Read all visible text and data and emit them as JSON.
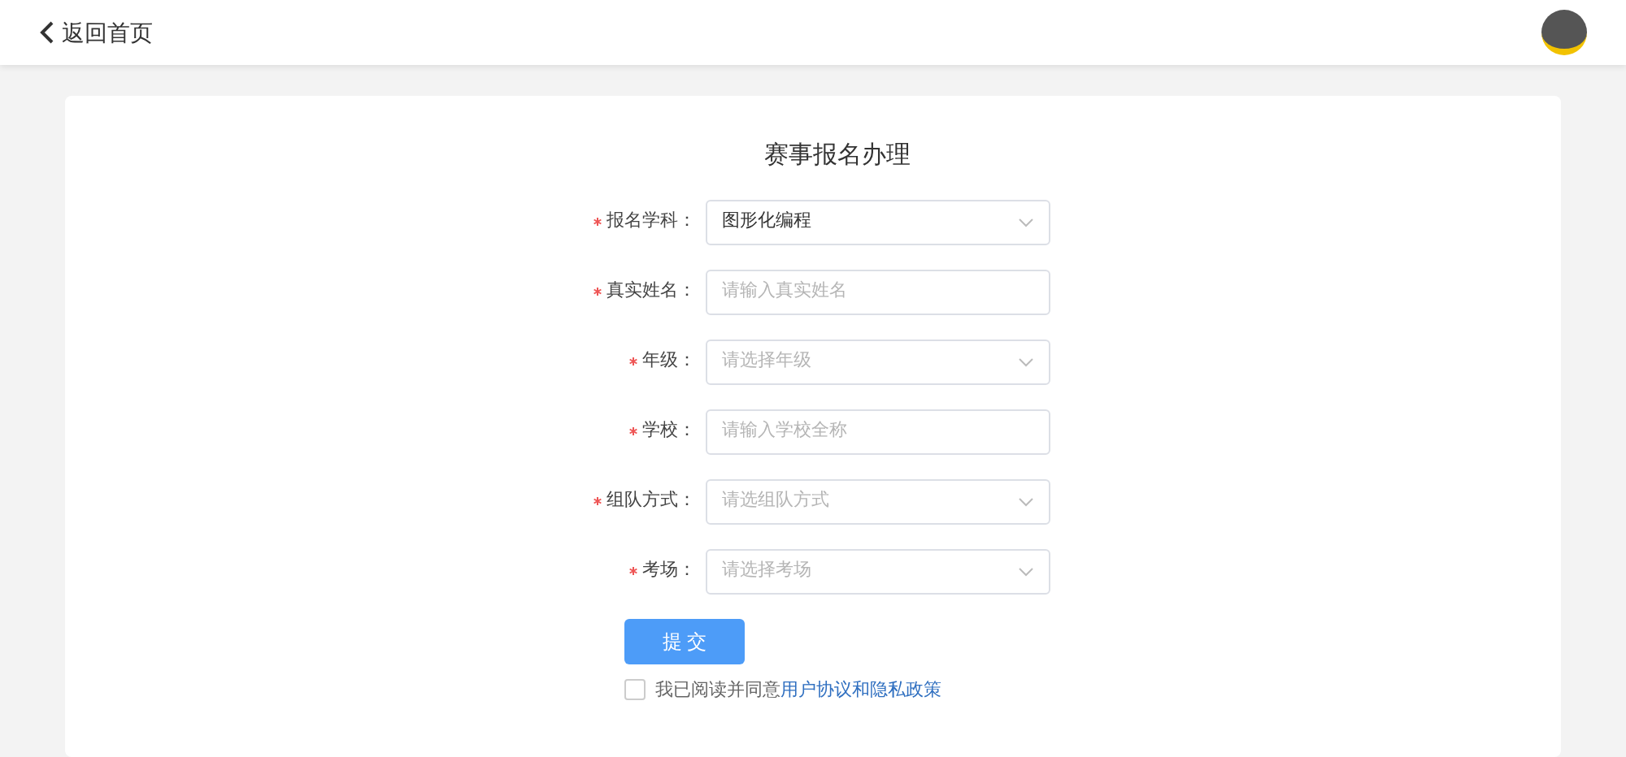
{
  "header": {
    "back_label": "返回首页"
  },
  "form": {
    "title": "赛事报名办理",
    "fields": [
      {
        "kind": "select",
        "label": "报名学科：",
        "required": true,
        "value": "图形化编程"
      },
      {
        "kind": "input",
        "label": "真实姓名：",
        "required": true,
        "placeholder": "请输入真实姓名"
      },
      {
        "kind": "select",
        "label": "年级：",
        "required": true,
        "placeholder": "请选择年级"
      },
      {
        "kind": "input",
        "label": "学校：",
        "required": true,
        "placeholder": "请输入学校全称"
      },
      {
        "kind": "select",
        "label": "组队方式：",
        "required": true,
        "placeholder": "请选组队方式"
      },
      {
        "kind": "select",
        "label": "考场：",
        "required": true,
        "placeholder": "请选择考场"
      }
    ],
    "submit_label": "提 交",
    "agreement": {
      "checked": false,
      "text": "我已阅读并同意",
      "links": [
        "用户协议",
        "隐私政策"
      ],
      "joiner": "和"
    }
  }
}
